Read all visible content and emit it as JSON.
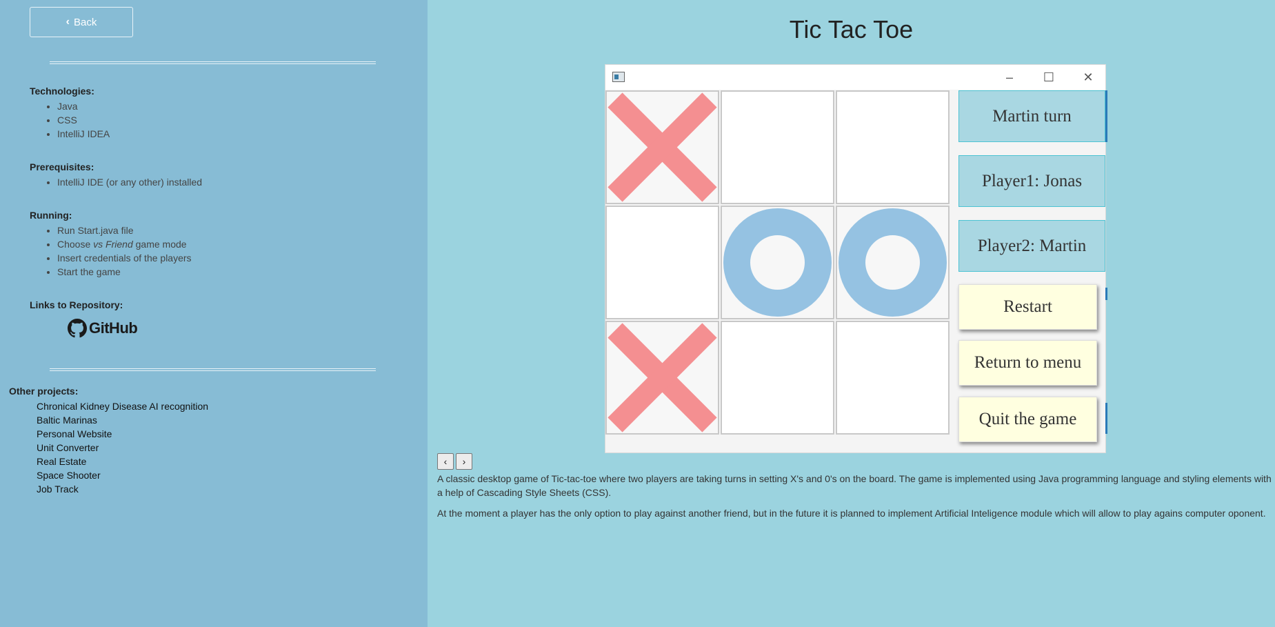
{
  "sidebar": {
    "back_label": "Back",
    "technologies": {
      "heading": "Technologies:",
      "items": [
        "Java",
        "CSS",
        "IntelliJ IDEA"
      ]
    },
    "prerequisites": {
      "heading": "Prerequisites:",
      "items": [
        "IntelliJ IDE (or any other) installed"
      ]
    },
    "running": {
      "heading": "Running:",
      "items": [
        "Run Start.java file",
        "Choose ",
        "vs Friend",
        " game mode",
        "Insert credentials of the players",
        "Start the game"
      ]
    },
    "links": {
      "heading": "Links to Repository:",
      "github_label": "GitHub"
    },
    "other": {
      "heading": "Other projects:",
      "items": [
        "Chronical Kidney Disease AI recognition",
        "Baltic Marinas",
        "Personal Website",
        "Unit Converter",
        "Real Estate",
        "Space Shooter",
        "Job Track"
      ]
    }
  },
  "main": {
    "title": "Tic Tac Toe",
    "game": {
      "board": [
        "X",
        "",
        "",
        "",
        "O",
        "O",
        "X",
        "",
        ""
      ],
      "turn_label": "Martin turn",
      "player1_label": "Player1: Jonas",
      "player2_label": "Player2: Martin",
      "restart_label": "Restart",
      "menu_label": "Return to menu",
      "quit_label": "Quit the game",
      "colors": {
        "x": "#f48f91",
        "o": "#95c2e2"
      }
    },
    "gallery": {
      "prev_label": "‹",
      "next_label": "›"
    },
    "description": [
      "A classic desktop game of Tic-tac-toe where two players are taking turns in setting X's and 0's on the board. The game is implemented using Java programming language and styling elements with a help of Cascading Style Sheets (CSS).",
      "At the moment a player has the only option to play against another friend, but in the future it is planned to implement Artificial Inteligence module which will allow to play agains computer oponent."
    ]
  }
}
